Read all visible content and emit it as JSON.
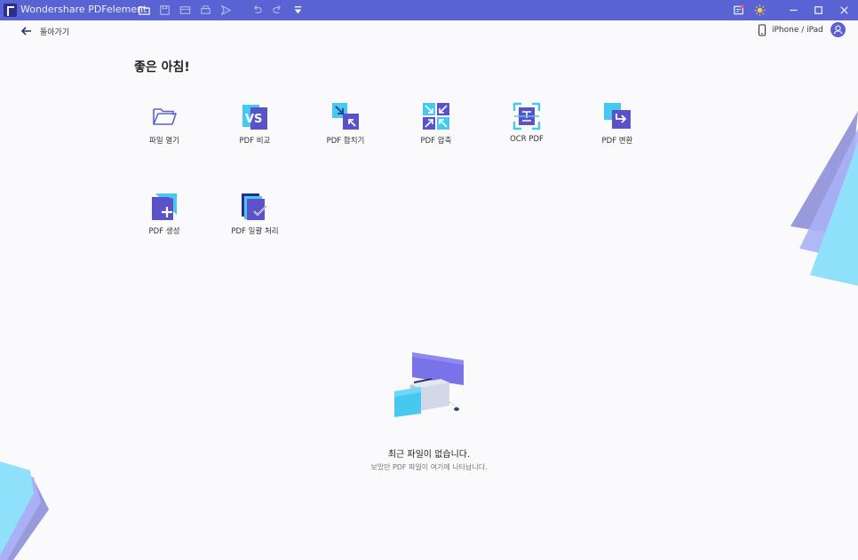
{
  "window": {
    "title": "Wondershare PDFelement"
  },
  "header": {
    "back_label": "돌아가기",
    "device_label": "iPhone / iPad"
  },
  "greeting": "좋은 아침!",
  "tools": [
    {
      "label": "파일 열기",
      "icon": "folder-open-icon"
    },
    {
      "label": "PDF 비교",
      "icon": "compare-icon"
    },
    {
      "label": "PDF 합치기",
      "icon": "merge-icon"
    },
    {
      "label": "PDF 압축",
      "icon": "compress-icon"
    },
    {
      "label": "OCR PDF",
      "icon": "ocr-icon"
    },
    {
      "label": "PDF 변환",
      "icon": "convert-icon"
    },
    {
      "label": "PDF 생성",
      "icon": "create-icon"
    },
    {
      "label": "PDF 일괄 처리",
      "icon": "batch-icon"
    }
  ],
  "empty_state": {
    "title": "최근 파일이 없습니다.",
    "subtitle": "보았던 PDF 파일이 여기에 나타납니다."
  },
  "colors": {
    "titlebar": "#5a63d3",
    "accent": "#5a63d3",
    "background": "#fafafc"
  }
}
